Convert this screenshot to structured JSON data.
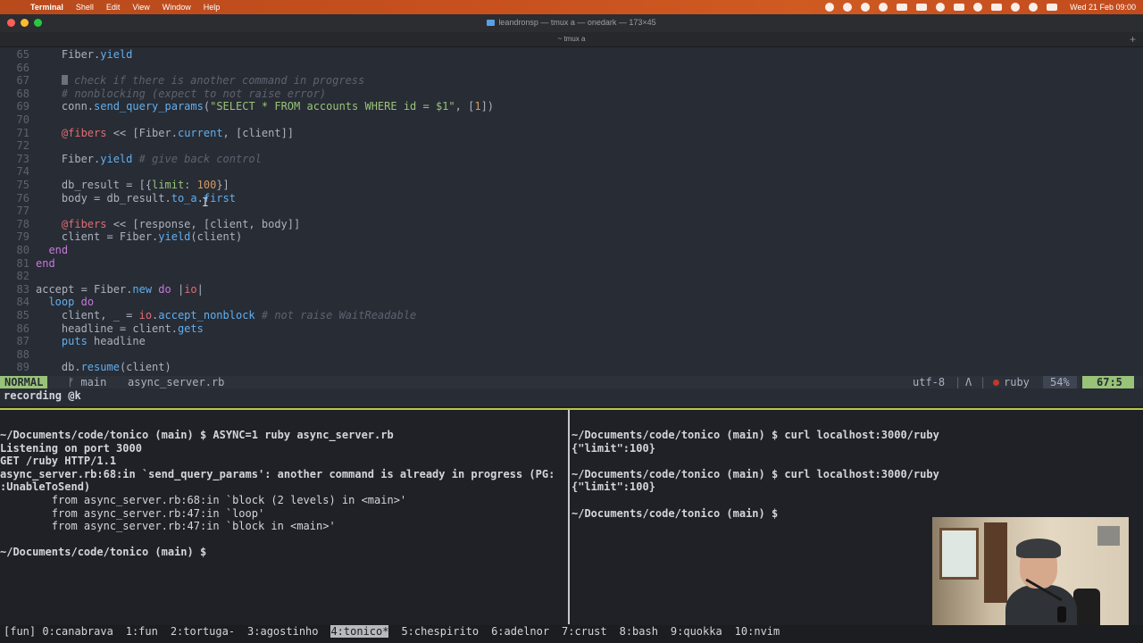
{
  "menubar": {
    "apple": "",
    "items": [
      "Terminal",
      "Shell",
      "Edit",
      "View",
      "Window",
      "Help"
    ],
    "status_icons": [
      "record-icon",
      "dnd-icon",
      "chrome-icon",
      "lock-icon",
      "wave-icon",
      "pen-icon",
      "app-icon",
      "battery-widget-icon",
      "moon-icon",
      "battery-icon",
      "wifi-icon",
      "search-icon",
      "control-center-icon",
      "user-icon"
    ],
    "clock": "Wed 21 Feb  09:00"
  },
  "window": {
    "title": "leandronsp — tmux a — onedark — 173×45",
    "tab": "~ tmux a"
  },
  "editor": {
    "lines": [
      {
        "n": "65",
        "t": [
          {
            "s": "    Fiber",
            "c": "code"
          },
          {
            "s": ".",
            "c": "code"
          },
          {
            "s": "yield",
            "c": "tok-f"
          }
        ]
      },
      {
        "n": "66",
        "t": []
      },
      {
        "n": "67",
        "t": [
          {
            "s": "    ",
            "c": "code"
          },
          {
            "s": "CURSOR",
            "c": "cursor"
          },
          {
            "s": " check if there is another command in progress",
            "c": "tok-c"
          }
        ]
      },
      {
        "n": "68",
        "t": [
          {
            "s": "    # nonblocking (expect to not raise error)",
            "c": "tok-c"
          }
        ]
      },
      {
        "n": "69",
        "t": [
          {
            "s": "    conn.",
            "c": "code"
          },
          {
            "s": "send_query_params",
            "c": "tok-f"
          },
          {
            "s": "(",
            "c": "code"
          },
          {
            "s": "\"SELECT * FROM accounts WHERE id = $1\"",
            "c": "tok-s"
          },
          {
            "s": ", [",
            "c": "code"
          },
          {
            "s": "1",
            "c": "tok-n"
          },
          {
            "s": "])",
            "c": "code"
          }
        ]
      },
      {
        "n": "70",
        "t": []
      },
      {
        "n": "71",
        "t": [
          {
            "s": "    ",
            "c": "code"
          },
          {
            "s": "@fibers",
            "c": "tok-i"
          },
          {
            "s": " << [",
            "c": "code"
          },
          {
            "s": "Fiber",
            "c": "code"
          },
          {
            "s": ".",
            "c": "code"
          },
          {
            "s": "current",
            "c": "tok-f"
          },
          {
            "s": ", [client]]",
            "c": "code"
          }
        ]
      },
      {
        "n": "72",
        "t": []
      },
      {
        "n": "73",
        "t": [
          {
            "s": "    Fiber.",
            "c": "code"
          },
          {
            "s": "yield",
            "c": "tok-f"
          },
          {
            "s": " # give back control",
            "c": "tok-c"
          }
        ]
      },
      {
        "n": "74",
        "t": []
      },
      {
        "n": "75",
        "t": [
          {
            "s": "    db_result = [{",
            "c": "code"
          },
          {
            "s": "limit:",
            "c": "tok-s"
          },
          {
            "s": " ",
            "c": "code"
          },
          {
            "s": "100",
            "c": "tok-n"
          },
          {
            "s": "}]",
            "c": "code"
          }
        ]
      },
      {
        "n": "76",
        "t": [
          {
            "s": "    body = db_result.",
            "c": "code"
          },
          {
            "s": "to_a",
            "c": "tok-f"
          },
          {
            "s": ".",
            "c": "code"
          },
          {
            "s": "first",
            "c": "tok-f"
          }
        ]
      },
      {
        "n": "77",
        "t": []
      },
      {
        "n": "78",
        "t": [
          {
            "s": "    ",
            "c": "code"
          },
          {
            "s": "@fibers",
            "c": "tok-i"
          },
          {
            "s": " << [response, [client, body]]",
            "c": "code"
          }
        ]
      },
      {
        "n": "79",
        "t": [
          {
            "s": "    client = Fiber.",
            "c": "code"
          },
          {
            "s": "yield",
            "c": "tok-f"
          },
          {
            "s": "(client)",
            "c": "code"
          }
        ]
      },
      {
        "n": "80",
        "t": [
          {
            "s": "  ",
            "c": "code"
          },
          {
            "s": "end",
            "c": "tok-k"
          }
        ]
      },
      {
        "n": "81",
        "t": [
          {
            "s": "end",
            "c": "tok-k"
          }
        ]
      },
      {
        "n": "82",
        "t": []
      },
      {
        "n": "83",
        "t": [
          {
            "s": "accept = Fiber.",
            "c": "code"
          },
          {
            "s": "new",
            "c": "tok-f"
          },
          {
            "s": " ",
            "c": "code"
          },
          {
            "s": "do",
            "c": "tok-k"
          },
          {
            "s": " |",
            "c": "code"
          },
          {
            "s": "io",
            "c": "tok-i"
          },
          {
            "s": "|",
            "c": "code"
          }
        ]
      },
      {
        "n": "84",
        "t": [
          {
            "s": "  ",
            "c": "code"
          },
          {
            "s": "loop",
            "c": "tok-f"
          },
          {
            "s": " ",
            "c": "code"
          },
          {
            "s": "do",
            "c": "tok-k"
          }
        ]
      },
      {
        "n": "85",
        "t": [
          {
            "s": "    client, _ = ",
            "c": "code"
          },
          {
            "s": "io",
            "c": "tok-i"
          },
          {
            "s": ".",
            "c": "code"
          },
          {
            "s": "accept_nonblock",
            "c": "tok-f"
          },
          {
            "s": " # not raise WaitReadable",
            "c": "tok-c"
          }
        ]
      },
      {
        "n": "86",
        "t": [
          {
            "s": "    headline = client.",
            "c": "code"
          },
          {
            "s": "gets",
            "c": "tok-f"
          }
        ]
      },
      {
        "n": "87",
        "t": [
          {
            "s": "    ",
            "c": "code"
          },
          {
            "s": "puts",
            "c": "tok-f"
          },
          {
            "s": " headline",
            "c": "code"
          }
        ]
      },
      {
        "n": "88",
        "t": []
      },
      {
        "n": "89",
        "t": [
          {
            "s": "    db.",
            "c": "code"
          },
          {
            "s": "resume",
            "c": "tok-f"
          },
          {
            "s": "(client)",
            "c": "code"
          }
        ]
      }
    ]
  },
  "statusline": {
    "mode": "NORMAL",
    "branch": "ᚠ main",
    "filename": "async_server.rb",
    "encoding": "utf-8",
    "sep1": "|",
    "os_icon": "Λ",
    "sep2": "|",
    "filetype": "ruby",
    "percent": "54%",
    "position": "67:5"
  },
  "cmdline": "recording @k",
  "pane_left": {
    "lines": [
      {
        "t": "~/Documents/code/tonico (main) $ ASYNC=1 ruby async_server.rb",
        "b": true
      },
      {
        "t": "Listening on port 3000",
        "b": true
      },
      {
        "t": "GET /ruby HTTP/1.1",
        "b": true
      },
      {
        "t": "async_server.rb:68:in `send_query_params': another command is already in progress (PG:",
        "b": true,
        "err": true
      },
      {
        "t": ":UnableToSend)",
        "b": true,
        "err2": true
      },
      {
        "t": "        from async_server.rb:68:in `block (2 levels) in <main>'",
        "b": false
      },
      {
        "t": "        from async_server.rb:47:in `loop'",
        "b": false
      },
      {
        "t": "        from async_server.rb:47:in `block in <main>'",
        "b": false
      },
      {
        "t": "",
        "b": false
      },
      {
        "t": "~/Documents/code/tonico (main) $",
        "b": true
      }
    ]
  },
  "pane_right": {
    "lines": [
      {
        "t": "~/Documents/code/tonico (main) $ curl localhost:3000/ruby",
        "b": true
      },
      {
        "t": "{\"limit\":100}",
        "b": true
      },
      {
        "t": "",
        "b": false
      },
      {
        "t": "~/Documents/code/tonico (main) $ curl localhost:3000/ruby",
        "b": true
      },
      {
        "t": "{\"limit\":100}",
        "b": true
      },
      {
        "t": "",
        "b": false
      },
      {
        "t": "~/Documents/code/tonico (main) $",
        "b": true
      }
    ]
  },
  "tmux": {
    "windows": [
      {
        "label": "[fun] 0:canabrava",
        "current": false
      },
      {
        "label": "1:fun",
        "current": false
      },
      {
        "label": "2:tortuga-",
        "current": false
      },
      {
        "label": "3:agostinho",
        "current": false
      },
      {
        "label": "4:tonico*",
        "current": true
      },
      {
        "label": "5:chespirito",
        "current": false
      },
      {
        "label": "6:adelnor",
        "current": false
      },
      {
        "label": "7:crust",
        "current": false
      },
      {
        "label": "8:bash",
        "current": false
      },
      {
        "label": "9:quokka",
        "current": false
      },
      {
        "label": "10:nvim",
        "current": false
      }
    ]
  },
  "colors": {
    "menubar": "#c7501e",
    "editor_bg": "#282c34",
    "mode_bg": "#98c379",
    "pane_separator": "#b7c84a"
  }
}
